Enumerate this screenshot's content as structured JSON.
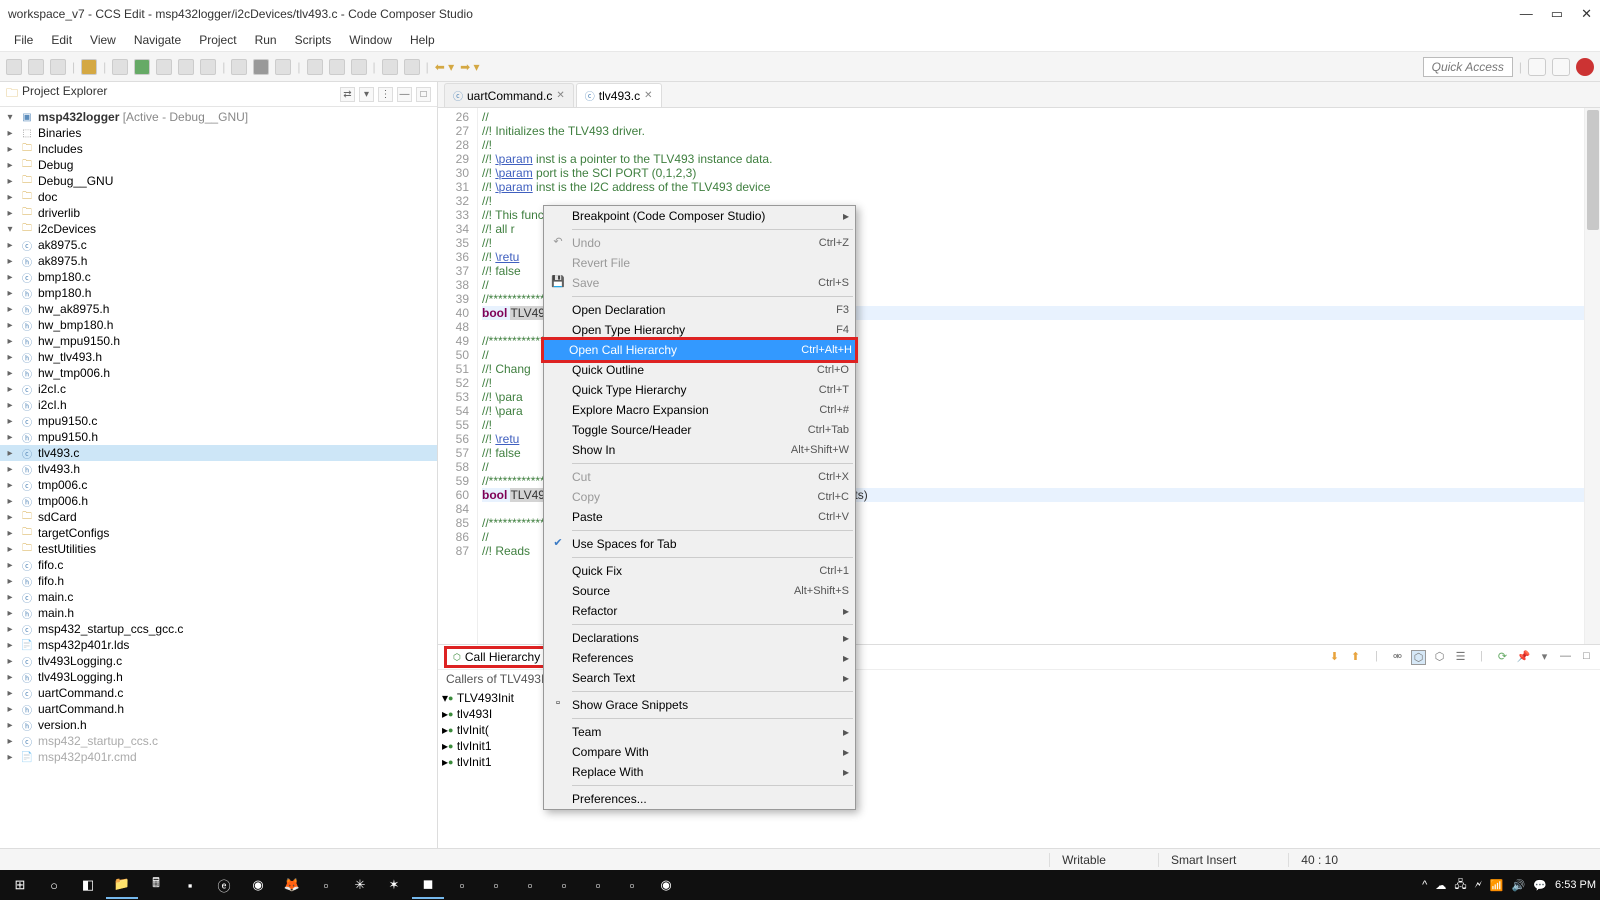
{
  "title": "workspace_v7 - CCS Edit - msp432logger/i2cDevices/tlv493.c - Code Composer Studio",
  "menu": [
    "File",
    "Edit",
    "View",
    "Navigate",
    "Project",
    "Run",
    "Scripts",
    "Window",
    "Help"
  ],
  "quick_access": "Quick Access",
  "project_explorer": {
    "title": "Project Explorer",
    "root": "msp432logger",
    "root_cfg": "[Active - Debug__GNU]",
    "items": [
      {
        "t": "Binaries",
        "k": "bin",
        "d": 2
      },
      {
        "t": "Includes",
        "k": "fld",
        "d": 2
      },
      {
        "t": "Debug",
        "k": "fld",
        "d": 2
      },
      {
        "t": "Debug__GNU",
        "k": "fld",
        "d": 2
      },
      {
        "t": "doc",
        "k": "fld",
        "d": 2
      },
      {
        "t": "driverlib",
        "k": "fld",
        "d": 2
      },
      {
        "t": "i2cDevices",
        "k": "fld",
        "d": 2,
        "open": true
      },
      {
        "t": "ak8975.c",
        "k": "c",
        "d": 3
      },
      {
        "t": "ak8975.h",
        "k": "h",
        "d": 3
      },
      {
        "t": "bmp180.c",
        "k": "c",
        "d": 3
      },
      {
        "t": "bmp180.h",
        "k": "h",
        "d": 3
      },
      {
        "t": "hw_ak8975.h",
        "k": "h",
        "d": 3
      },
      {
        "t": "hw_bmp180.h",
        "k": "h",
        "d": 3
      },
      {
        "t": "hw_mpu9150.h",
        "k": "h",
        "d": 3
      },
      {
        "t": "hw_tlv493.h",
        "k": "h",
        "d": 3
      },
      {
        "t": "hw_tmp006.h",
        "k": "h",
        "d": 3
      },
      {
        "t": "i2cI.c",
        "k": "c",
        "d": 3
      },
      {
        "t": "i2cI.h",
        "k": "h",
        "d": 3
      },
      {
        "t": "mpu9150.c",
        "k": "c",
        "d": 3
      },
      {
        "t": "mpu9150.h",
        "k": "h",
        "d": 3
      },
      {
        "t": "tlv493.c",
        "k": "c",
        "d": 3,
        "sel": true
      },
      {
        "t": "tlv493.h",
        "k": "h",
        "d": 3
      },
      {
        "t": "tmp006.c",
        "k": "c",
        "d": 3
      },
      {
        "t": "tmp006.h",
        "k": "h",
        "d": 3
      },
      {
        "t": "sdCard",
        "k": "fld",
        "d": 2
      },
      {
        "t": "targetConfigs",
        "k": "fld",
        "d": 2
      },
      {
        "t": "testUtilities",
        "k": "fld",
        "d": 2
      },
      {
        "t": "fifo.c",
        "k": "c",
        "d": 2
      },
      {
        "t": "fifo.h",
        "k": "h",
        "d": 2
      },
      {
        "t": "main.c",
        "k": "c",
        "d": 2
      },
      {
        "t": "main.h",
        "k": "h",
        "d": 2
      },
      {
        "t": "msp432_startup_ccs_gcc.c",
        "k": "c",
        "d": 2
      },
      {
        "t": "msp432p401r.lds",
        "k": "f",
        "d": 2
      },
      {
        "t": "tlv493Logging.c",
        "k": "c",
        "d": 2
      },
      {
        "t": "tlv493Logging.h",
        "k": "h",
        "d": 2
      },
      {
        "t": "uartCommand.c",
        "k": "c",
        "d": 2
      },
      {
        "t": "uartCommand.h",
        "k": "h",
        "d": 2
      },
      {
        "t": "version.h",
        "k": "h",
        "d": 2
      },
      {
        "t": "msp432_startup_ccs.c",
        "k": "c",
        "d": 2,
        "dim": true
      },
      {
        "t": "msp432p401r.cmd",
        "k": "f",
        "d": 2,
        "dim": true
      }
    ]
  },
  "tabs": [
    {
      "name": "uartCommand.c",
      "active": false
    },
    {
      "name": "tlv493.c",
      "active": true
    }
  ],
  "code": {
    "start": 26,
    "lines": [
      "//",
      "//! Initializes the TLV493 driver.",
      "//!",
      "//! \\param inst is a pointer to the TLV493 instance data.",
      "//! \\param port is the SCI PORT (0,1,2,3)",
      "//! \\param inst is the I2C address of the TLV493 device",
      "//!",
      "//! This function initializes the TLV493 driver instance by reading",
      "//! all r",
      "//!",
      "//! \\retu                                                       lly initialized and",
      "//! false",
      "//",
      "//********************                                           *********************",
      "bool TLV49",
      "",
      "//********************                                           *********************",
      "//",
      "//! Chang                                                        onds",
      "//!",
      "//! \\para",
      "//! \\para                                                         1,2,3) to use",
      "//!",
      "//! \\retu                                                         fully changed and",
      "//! false",
      "//",
      "//********************                                           *********************",
      "bool TLV49                                                        *inst, uint8_t addressBits)",
      "",
      "//********************                                           *********************",
      "//",
      "//! Reads"
    ],
    "special": {
      "line40": true,
      "line48": 48,
      "line60": true,
      "line84": 84
    }
  },
  "call_hierarchy": {
    "title": "Call Hierarchy",
    "subtitle": "Callers of TLV493Init                                                                           orkspace",
    "tree": [
      {
        "t": "TLV493Init",
        "d": 1,
        "open": true
      },
      {
        "t": "tlv493I",
        "d": 2
      },
      {
        "t": "tlvInit(",
        "d": 2
      },
      {
        "t": "tlvInit1",
        "d": 2
      },
      {
        "t": "tlvInit1",
        "d": 2
      }
    ]
  },
  "context_menu": [
    {
      "t": "Breakpoint (Code Composer Studio)",
      "sub": true
    },
    {
      "sep": true
    },
    {
      "t": "Undo",
      "s": "Ctrl+Z",
      "ico": "↶",
      "dis": true
    },
    {
      "t": "Revert File",
      "dis": true
    },
    {
      "t": "Save",
      "s": "Ctrl+S",
      "ico": "💾",
      "dis": true
    },
    {
      "sep": true
    },
    {
      "t": "Open Declaration",
      "s": "F3"
    },
    {
      "t": "Open Type Hierarchy",
      "s": "F4"
    },
    {
      "t": "Open Call Hierarchy",
      "s": "Ctrl+Alt+H",
      "hl": true
    },
    {
      "t": "Quick Outline",
      "s": "Ctrl+O"
    },
    {
      "t": "Quick Type Hierarchy",
      "s": "Ctrl+T"
    },
    {
      "t": "Explore Macro Expansion",
      "s": "Ctrl+#"
    },
    {
      "t": "Toggle Source/Header",
      "s": "Ctrl+Tab"
    },
    {
      "t": "Show In",
      "s": "Alt+Shift+W",
      "sub": true
    },
    {
      "sep": true
    },
    {
      "t": "Cut",
      "s": "Ctrl+X",
      "dis": true
    },
    {
      "t": "Copy",
      "s": "Ctrl+C",
      "dis": true
    },
    {
      "t": "Paste",
      "s": "Ctrl+V"
    },
    {
      "sep": true
    },
    {
      "t": "Use Spaces for Tab",
      "chk": true
    },
    {
      "sep": true
    },
    {
      "t": "Quick Fix",
      "s": "Ctrl+1"
    },
    {
      "t": "Source",
      "s": "Alt+Shift+S",
      "sub": true
    },
    {
      "t": "Refactor",
      "sub": true
    },
    {
      "sep": true
    },
    {
      "t": "Declarations",
      "sub": true
    },
    {
      "t": "References",
      "sub": true
    },
    {
      "t": "Search Text",
      "sub": true
    },
    {
      "sep": true
    },
    {
      "t": "Show Grace Snippets",
      "ico": "▫"
    },
    {
      "sep": true
    },
    {
      "t": "Team",
      "sub": true
    },
    {
      "t": "Compare With",
      "sub": true
    },
    {
      "t": "Replace With",
      "sub": true
    },
    {
      "sep": true
    },
    {
      "t": "Preferences..."
    }
  ],
  "status": {
    "writable": "Writable",
    "insert": "Smart Insert",
    "pos": "40 : 10"
  },
  "clock": "6:53 PM"
}
